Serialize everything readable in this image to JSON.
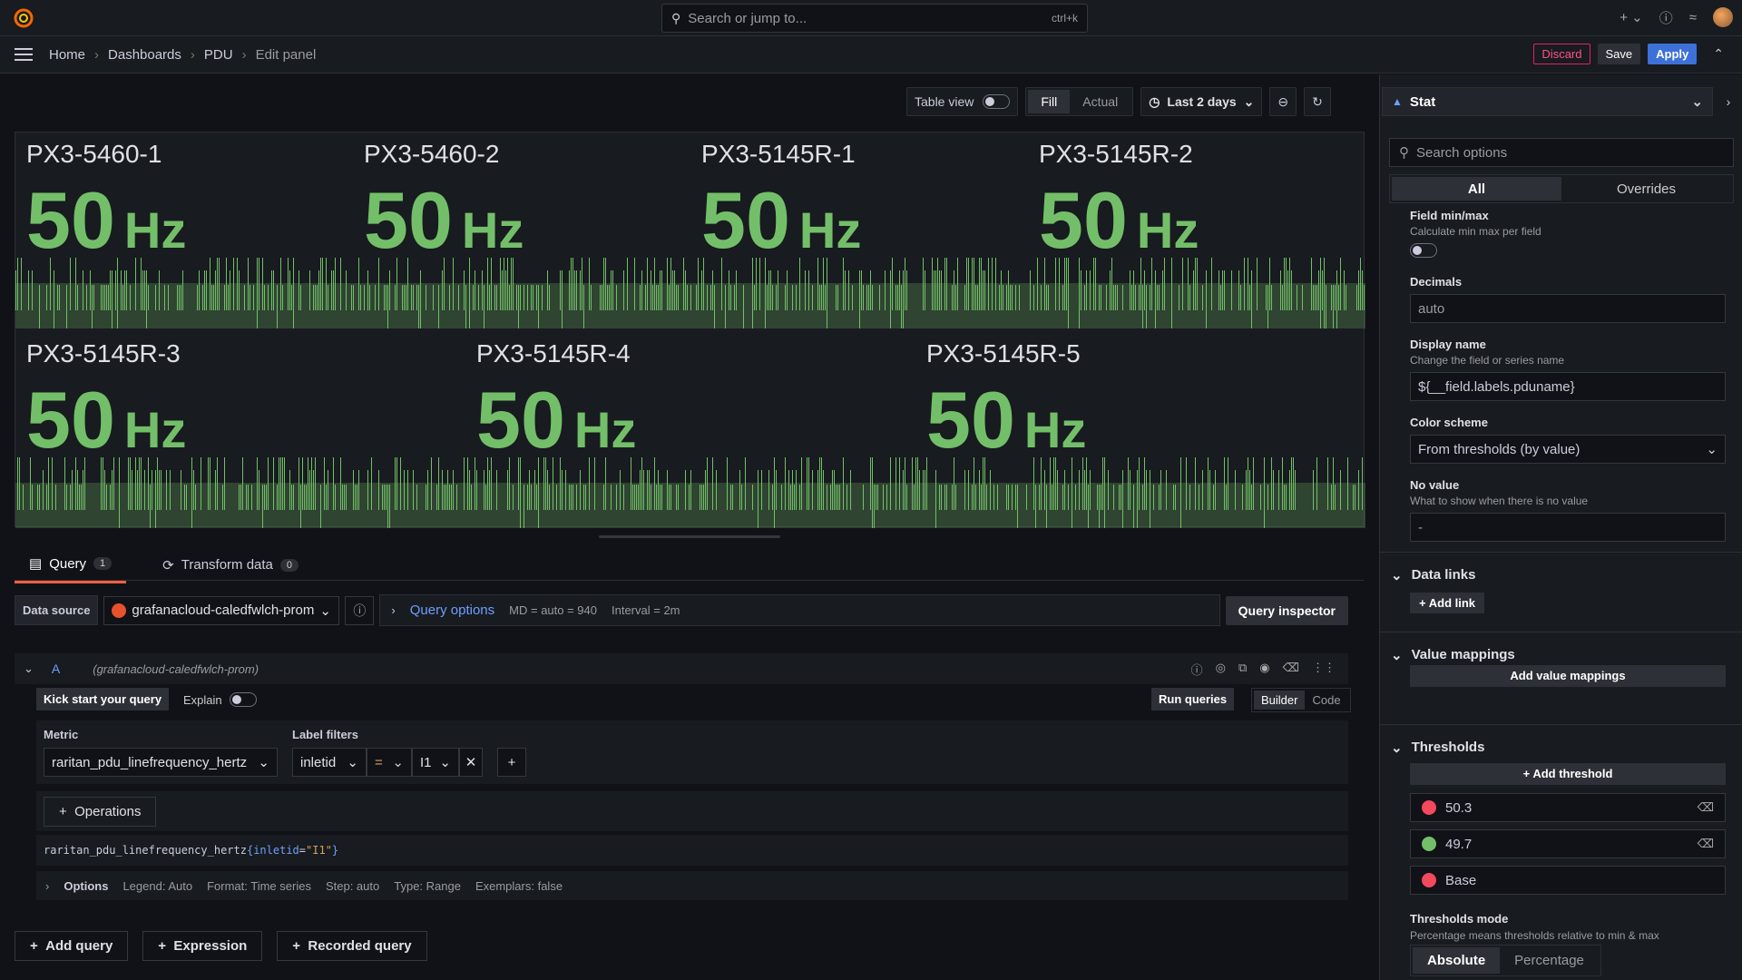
{
  "topbar": {
    "search_placeholder": "Search or jump to...",
    "search_shortcut": "ctrl+k"
  },
  "breadcrumb": [
    "Home",
    "Dashboards",
    "PDU",
    "Edit panel"
  ],
  "actions": {
    "discard": "Discard",
    "save": "Save",
    "apply": "Apply"
  },
  "panel_toolbar": {
    "table_view": "Table view",
    "fill": "Fill",
    "actual": "Actual",
    "time_range": "Last 2 days"
  },
  "stats": [
    {
      "title": "PX3-5460-1",
      "value": "50",
      "unit": "Hz"
    },
    {
      "title": "PX3-5460-2",
      "value": "50",
      "unit": "Hz"
    },
    {
      "title": "PX3-5145R-1",
      "value": "50",
      "unit": "Hz"
    },
    {
      "title": "PX3-5145R-2",
      "value": "50",
      "unit": "Hz"
    },
    {
      "title": "PX3-5145R-3",
      "value": "50",
      "unit": "Hz"
    },
    {
      "title": "PX3-5145R-4",
      "value": "50",
      "unit": "Hz"
    },
    {
      "title": "PX3-5145R-5",
      "value": "50",
      "unit": "Hz"
    }
  ],
  "colors": {
    "green": "#73bf69",
    "red": "#f2495c",
    "accent": "#f55f3e",
    "blue": "#3d71d9"
  },
  "query_tabs": [
    {
      "label": "Query",
      "count": "1"
    },
    {
      "label": "Transform data",
      "count": "0"
    }
  ],
  "datasource": {
    "label": "Data source",
    "name": "grafanacloud-caledfwlch-prom",
    "query_options": "Query options",
    "md": "MD = auto = 940",
    "interval": "Interval = 2m",
    "inspector": "Query inspector"
  },
  "query": {
    "ref": "A",
    "ds": "(grafanacloud-caledfwlch-prom)",
    "kick": "Kick start your query",
    "explain": "Explain",
    "run": "Run queries",
    "builder": "Builder",
    "code": "Code",
    "metric_label": "Metric",
    "metric": "raritan_pdu_linefrequency_hertz",
    "label_filters": "Label filters",
    "filter_key": "inletid",
    "filter_op": "=",
    "filter_val": "I1",
    "operations": "Operations",
    "code_metric": "raritan_pdu_linefrequency_hertz",
    "code_open": "{",
    "code_label": "inletid",
    "code_eq": "=",
    "code_str": "\"I1\"",
    "code_close": "}",
    "opts_label": "Options",
    "opts": [
      "Legend: Auto",
      "Format: Time series",
      "Step: auto",
      "Type: Range",
      "Exemplars: false"
    ]
  },
  "add_buttons": [
    "Add query",
    "Expression",
    "Recorded query"
  ],
  "side": {
    "viz": "Stat",
    "search_placeholder": "Search options",
    "tabs": [
      "All",
      "Overrides"
    ],
    "minmax_title": "Field min/max",
    "minmax_desc": "Calculate min max per field",
    "decimals": "Decimals",
    "decimals_val": "auto",
    "display_name": "Display name",
    "display_name_desc": "Change the field or series name",
    "display_name_val": "${__field.labels.pduname}",
    "color_scheme": "Color scheme",
    "color_scheme_val": "From thresholds (by value)",
    "no_value": "No value",
    "no_value_desc": "What to show when there is no value",
    "no_value_ph": "-",
    "data_links": "Data links",
    "add_link": "Add link",
    "value_mappings": "Value mappings",
    "add_value_mappings": "Add value mappings",
    "thresholds": "Thresholds",
    "add_threshold": "Add threshold",
    "threshold_items": [
      {
        "value": "50.3",
        "color": "#f2495c"
      },
      {
        "value": "49.7",
        "color": "#73bf69"
      },
      {
        "value": "Base",
        "color": "#f2495c"
      }
    ],
    "thresholds_mode": "Thresholds mode",
    "thresholds_mode_desc": "Percentage means thresholds relative to min & max",
    "mode_opts": [
      "Absolute",
      "Percentage"
    ]
  }
}
